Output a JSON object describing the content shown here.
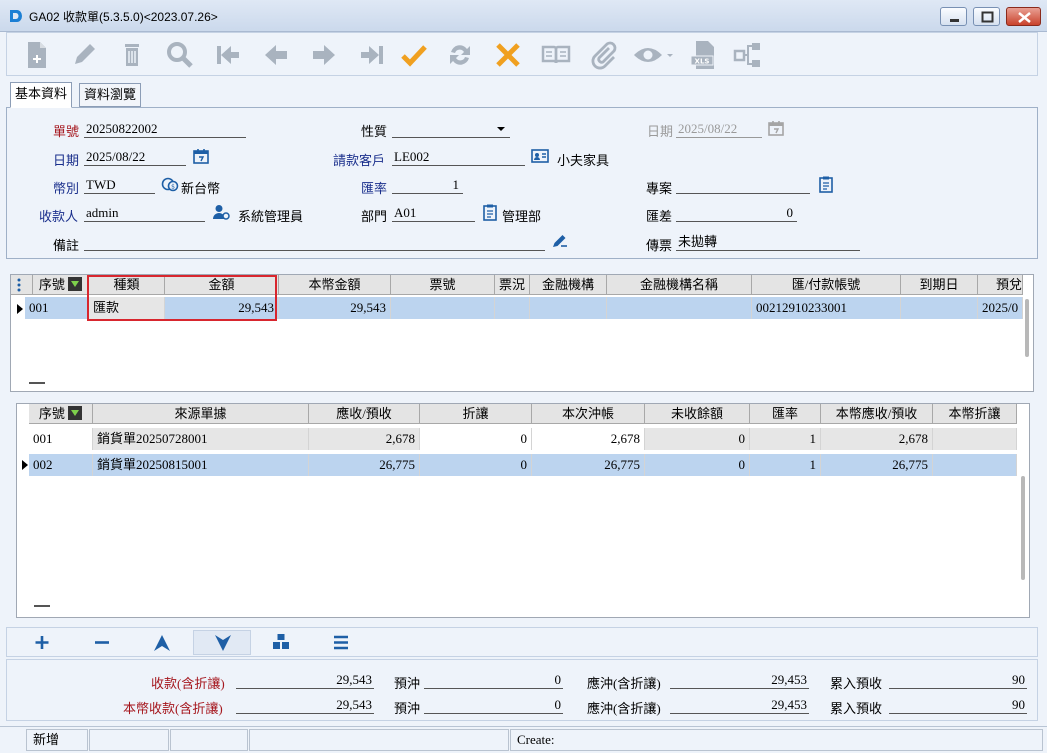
{
  "window": {
    "title": "GA02 收款單(5.3.5.0)<2023.07.26>"
  },
  "tabs": [
    {
      "label": "基本資料"
    },
    {
      "label": "資料瀏覽"
    }
  ],
  "form": {
    "voucher_no": {
      "label": "單號",
      "value": "20250822002"
    },
    "nature": {
      "label": "性質",
      "value": ""
    },
    "date_top": {
      "label": "日期",
      "value": "2025/08/22"
    },
    "date": {
      "label": "日期",
      "value": "2025/08/22"
    },
    "customer": {
      "label": "請款客戶",
      "value": "LE002",
      "name": "小夫家具"
    },
    "currency": {
      "label": "幣別",
      "value": "TWD",
      "name": "新台幣"
    },
    "rate": {
      "label": "匯率",
      "value": "1"
    },
    "project": {
      "label": "專案",
      "value": ""
    },
    "payee": {
      "label": "收款人",
      "value": "admin",
      "name": "系統管理員"
    },
    "dept": {
      "label": "部門",
      "value": "A01",
      "name": "管理部"
    },
    "fx_diff": {
      "label": "匯差",
      "value": "0"
    },
    "memo": {
      "label": "備註",
      "value": ""
    },
    "transfer": {
      "label": "傳票",
      "value": "未拋轉"
    }
  },
  "grid1": {
    "headers": [
      "序號",
      "種類",
      "金額",
      "本幣金額",
      "票號",
      "票況",
      "金融機構",
      "金融機構名稱",
      "匯/付款帳號",
      "到期日",
      "預兌"
    ],
    "rows": [
      {
        "seq": "001",
        "type": "匯款",
        "amount": "29,543",
        "local_amount": "29,543",
        "ticket": "",
        "status": "",
        "bank": "",
        "bank_name": "",
        "account": "00212910233001",
        "due": "",
        "pre": "2025/0"
      }
    ]
  },
  "grid2": {
    "headers": [
      "序號",
      "來源單據",
      "應收/預收",
      "折讓",
      "本次沖帳",
      "未收餘額",
      "匯率",
      "本幣應收/預收",
      "本幣折讓"
    ],
    "rows": [
      {
        "seq": "001",
        "source": "銷貨單20250728001",
        "receivable": "2,678",
        "discount": "0",
        "offset": "2,678",
        "balance": "0",
        "rate": "1",
        "local_receivable": "2,678",
        "local_discount": ""
      },
      {
        "seq": "002",
        "source": "銷貨單20250815001",
        "receivable": "26,775",
        "discount": "0",
        "offset": "26,775",
        "balance": "0",
        "rate": "1",
        "local_receivable": "26,775",
        "local_discount": ""
      }
    ]
  },
  "summary": {
    "received": {
      "label": "收款(含折讓)",
      "value": "29,543"
    },
    "prepay1": {
      "label": "預沖",
      "value": "0"
    },
    "offset1": {
      "label": "應沖(含折讓)",
      "value": "29,453"
    },
    "accum1": {
      "label": "累入預收",
      "value": "90"
    },
    "local_received": {
      "label": "本幣收款(含折讓)",
      "value": "29,543"
    },
    "prepay2": {
      "label": "預沖",
      "value": "0"
    },
    "offset2": {
      "label": "應沖(含折讓)",
      "value": "29,453"
    },
    "accum2": {
      "label": "累入預收",
      "value": "90"
    }
  },
  "status": {
    "mode": "新增",
    "create": "Create:"
  },
  "colors": {
    "accent_red": "#d8262e",
    "label_red": "#a5161d",
    "label_blue": "#1a2f8c",
    "selection": "#bcd4ef"
  }
}
